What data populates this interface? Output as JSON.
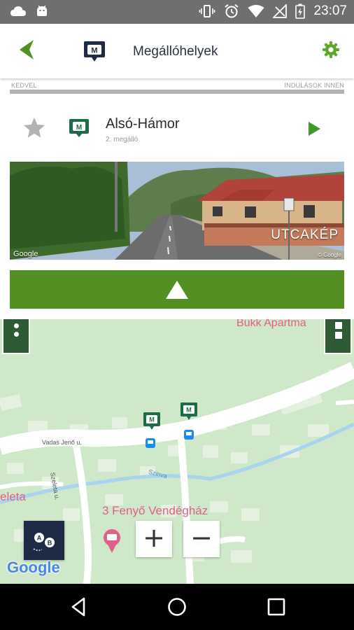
{
  "status_bar": {
    "time": "23:07",
    "left_icons": [
      "cloud-icon",
      "android-icon"
    ],
    "right_icons": [
      "vibrate-icon",
      "alarm-icon",
      "wifi-icon",
      "no-signal-icon",
      "battery-charging-icon"
    ]
  },
  "app_bar": {
    "title": "Megállóhelyek",
    "back_icon": "back-arrow-icon",
    "logo_icon": "metro-m-icon",
    "settings_icon": "gear-icon"
  },
  "columns": {
    "left": "KEDVEL",
    "right": "INDULÁSOK INNEN"
  },
  "stop": {
    "name": "Alsó-Hámor",
    "subtitle": "2. megálló",
    "favorite_icon": "star-icon",
    "type_icon": "metro-m-icon",
    "go_icon": "play-icon"
  },
  "street_view": {
    "label": "UTCAKÉP",
    "watermark": "Google",
    "copyright": "© Google"
  },
  "collapse_icon": "triangle-up-icon",
  "map": {
    "labels": {
      "top_place": "Bükk Apartma",
      "street_1": "Vadas Jenő u.",
      "street_2": "Szeleta u.",
      "river": "Szinva",
      "left_place": "eleta",
      "lodging": "3 Fenyő Vendégház"
    },
    "google_logo": "Google",
    "route_icon": "route-ab-icon",
    "zoom_in": "+",
    "zoom_out": "−"
  },
  "colors": {
    "accent_green": "#538f22",
    "title_navy": "#2a3142",
    "map_bg": "#cfe8c9",
    "poi_pink": "#e0608a"
  },
  "nav_bar": {
    "back_icon": "nav-back-icon",
    "home_icon": "nav-home-icon",
    "recents_icon": "nav-recents-icon"
  }
}
